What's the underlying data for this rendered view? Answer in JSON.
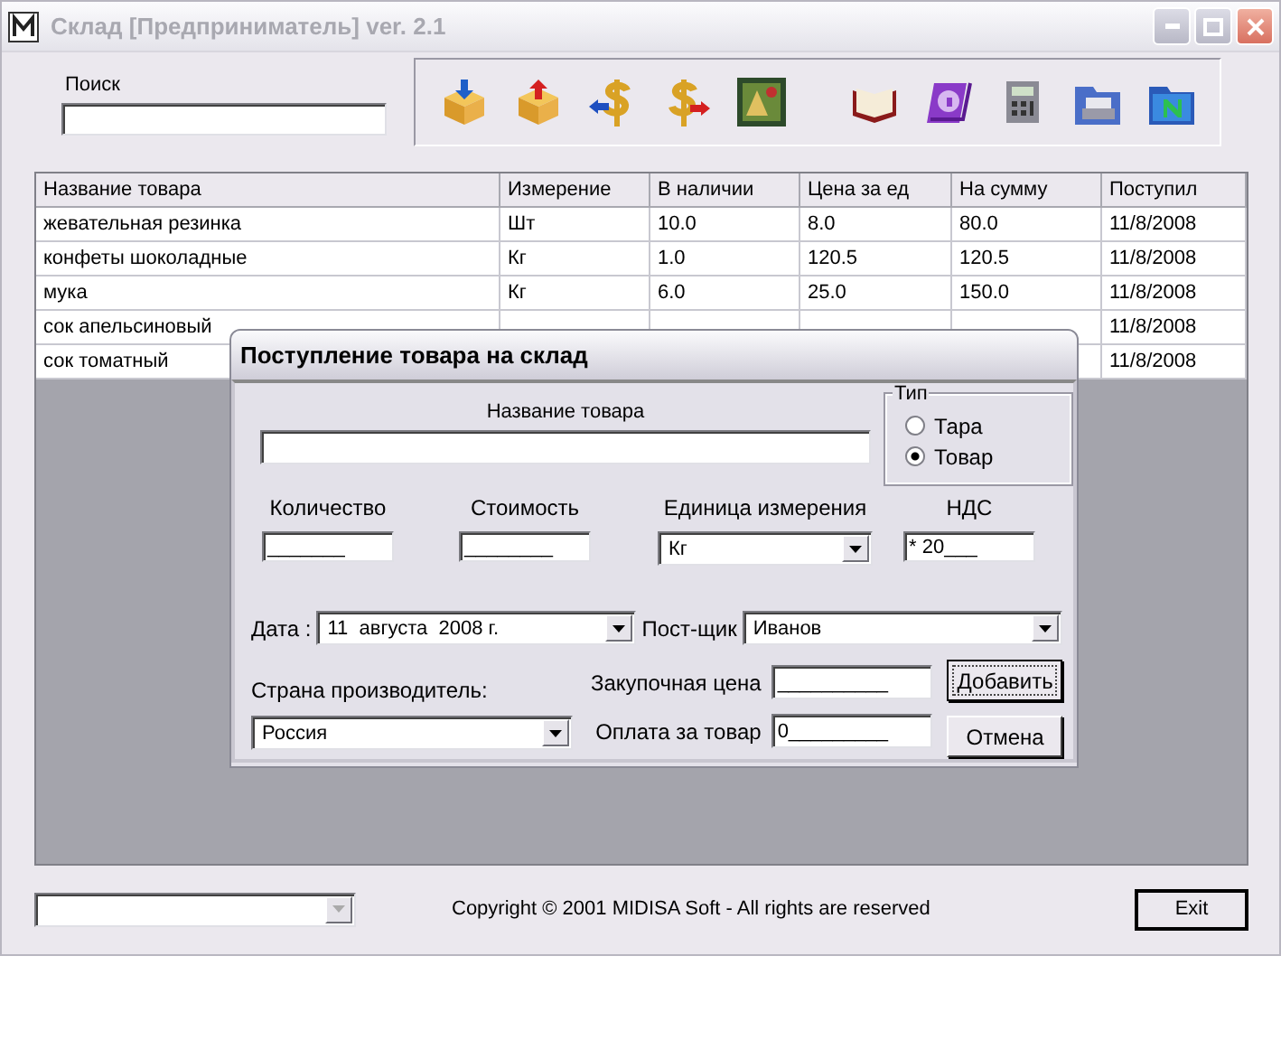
{
  "window": {
    "title": "Склад [Предприниматель] ver. 2.1"
  },
  "search": {
    "label": "Поиск"
  },
  "table": {
    "columns": [
      "Название товара",
      "Измерение",
      "В наличии",
      "Цена за ед",
      "На сумму",
      "Поступил"
    ],
    "rows": [
      {
        "name": "жевательная резинка",
        "unit": "Шт",
        "stock": "10.0",
        "price": "8.0",
        "sum": "80.0",
        "received": "11/8/2008"
      },
      {
        "name": "конфеты шоколадные",
        "unit": "Кг",
        "stock": "1.0",
        "price": "120.5",
        "sum": "120.5",
        "received": "11/8/2008"
      },
      {
        "name": "мука",
        "unit": "Кг",
        "stock": "6.0",
        "price": "25.0",
        "sum": "150.0",
        "received": "11/8/2008"
      },
      {
        "name": "сок апельсиновый",
        "received": "11/8/2008"
      },
      {
        "name": "сок томатный",
        "received": "11/8/2008"
      }
    ]
  },
  "dialog": {
    "title": "Поступление товара на склад",
    "product_name": {
      "label": "Название товара"
    },
    "type_group": {
      "label": "Тип",
      "options": [
        {
          "label": "Тара",
          "selected": false
        },
        {
          "label": "Товар",
          "selected": true
        }
      ]
    },
    "quantity": {
      "label": "Количество",
      "value": "_______"
    },
    "cost": {
      "label": "Стоимость",
      "value": "________"
    },
    "unit": {
      "label": "Единица измерения",
      "value": "Кг"
    },
    "vat": {
      "label": "НДС",
      "value": "* 20___"
    },
    "date": {
      "label": "Дата :",
      "value": "11  августа  2008 г."
    },
    "supplier": {
      "label": "Пост-щик",
      "value": "Иванов"
    },
    "country": {
      "label": "Страна производитель:",
      "value": "Россия"
    },
    "purchase_price": {
      "label": "Закупочная цена",
      "value": "__________"
    },
    "payment": {
      "label": "Оплата за товар",
      "value": "0_________"
    },
    "buttons": [
      "Добавить",
      "Отмена"
    ]
  },
  "footer": {
    "copyright": "Copyright © 2001 MIDISA Soft - All rights are reserved",
    "exit": "Exit"
  }
}
